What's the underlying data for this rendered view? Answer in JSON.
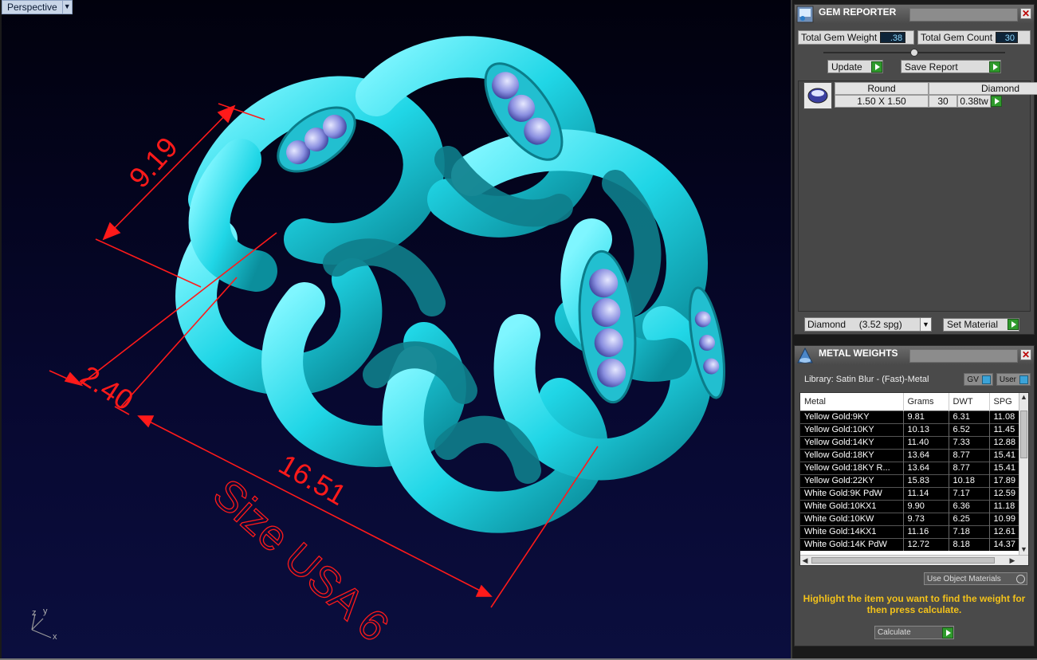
{
  "viewport": {
    "label": "Perspective",
    "dimensions": {
      "d1": "9.19",
      "d2": "2.40",
      "d3": "16.51"
    },
    "size_text": "Size USA 6",
    "axes": {
      "x": "x",
      "y": "y",
      "z": "z"
    },
    "colors": {
      "model": "#1fd7e6",
      "dims": "#ff1a1a",
      "bg": "#05062a"
    }
  },
  "gem_reporter": {
    "title": "GEM REPORTER",
    "total_weight_label": "Total Gem Weight",
    "total_weight_value": ".38",
    "total_count_label": "Total Gem Count",
    "total_count_value": "30",
    "update_label": "Update",
    "save_label": "Save Report",
    "row": {
      "shape": "Round",
      "type": "Diamond",
      "size": "1.50 X 1.50",
      "count": "30",
      "weight": "0.38tw"
    },
    "material_select": "Diamond     (3.52 spg)",
    "set_material_label": "Set Material"
  },
  "metal_weights": {
    "title": "METAL WEIGHTS",
    "library": "Library: Satin Blur - (Fast)-Metal",
    "gv_label": "GV",
    "user_label": "User",
    "columns": [
      "Metal",
      "Grams",
      "DWT",
      "SPG"
    ],
    "rows": [
      [
        "Yellow Gold:9KY",
        "9.81",
        "6.31",
        "11.08"
      ],
      [
        "Yellow Gold:10KY",
        "10.13",
        "6.52",
        "11.45"
      ],
      [
        "Yellow Gold:14KY",
        "11.40",
        "7.33",
        "12.88"
      ],
      [
        "Yellow Gold:18KY",
        "13.64",
        "8.77",
        "15.41"
      ],
      [
        "Yellow Gold:18KY R...",
        "13.64",
        "8.77",
        "15.41"
      ],
      [
        "Yellow Gold:22KY",
        "15.83",
        "10.18",
        "17.89"
      ],
      [
        "White Gold:9K PdW",
        "11.14",
        "7.17",
        "12.59"
      ],
      [
        "White Gold:10KX1",
        "9.90",
        "6.36",
        "11.18"
      ],
      [
        "White Gold:10KW",
        "9.73",
        "6.25",
        "10.99"
      ],
      [
        "White Gold:14KX1",
        "11.16",
        "7.18",
        "12.61"
      ],
      [
        "White Gold:14K PdW",
        "12.72",
        "8.18",
        "14.37"
      ]
    ],
    "use_object_label": "Use Object Materials",
    "instruction": "Highlight the item you want to find the weight for then press calculate.",
    "calculate_label": "Calculate"
  }
}
